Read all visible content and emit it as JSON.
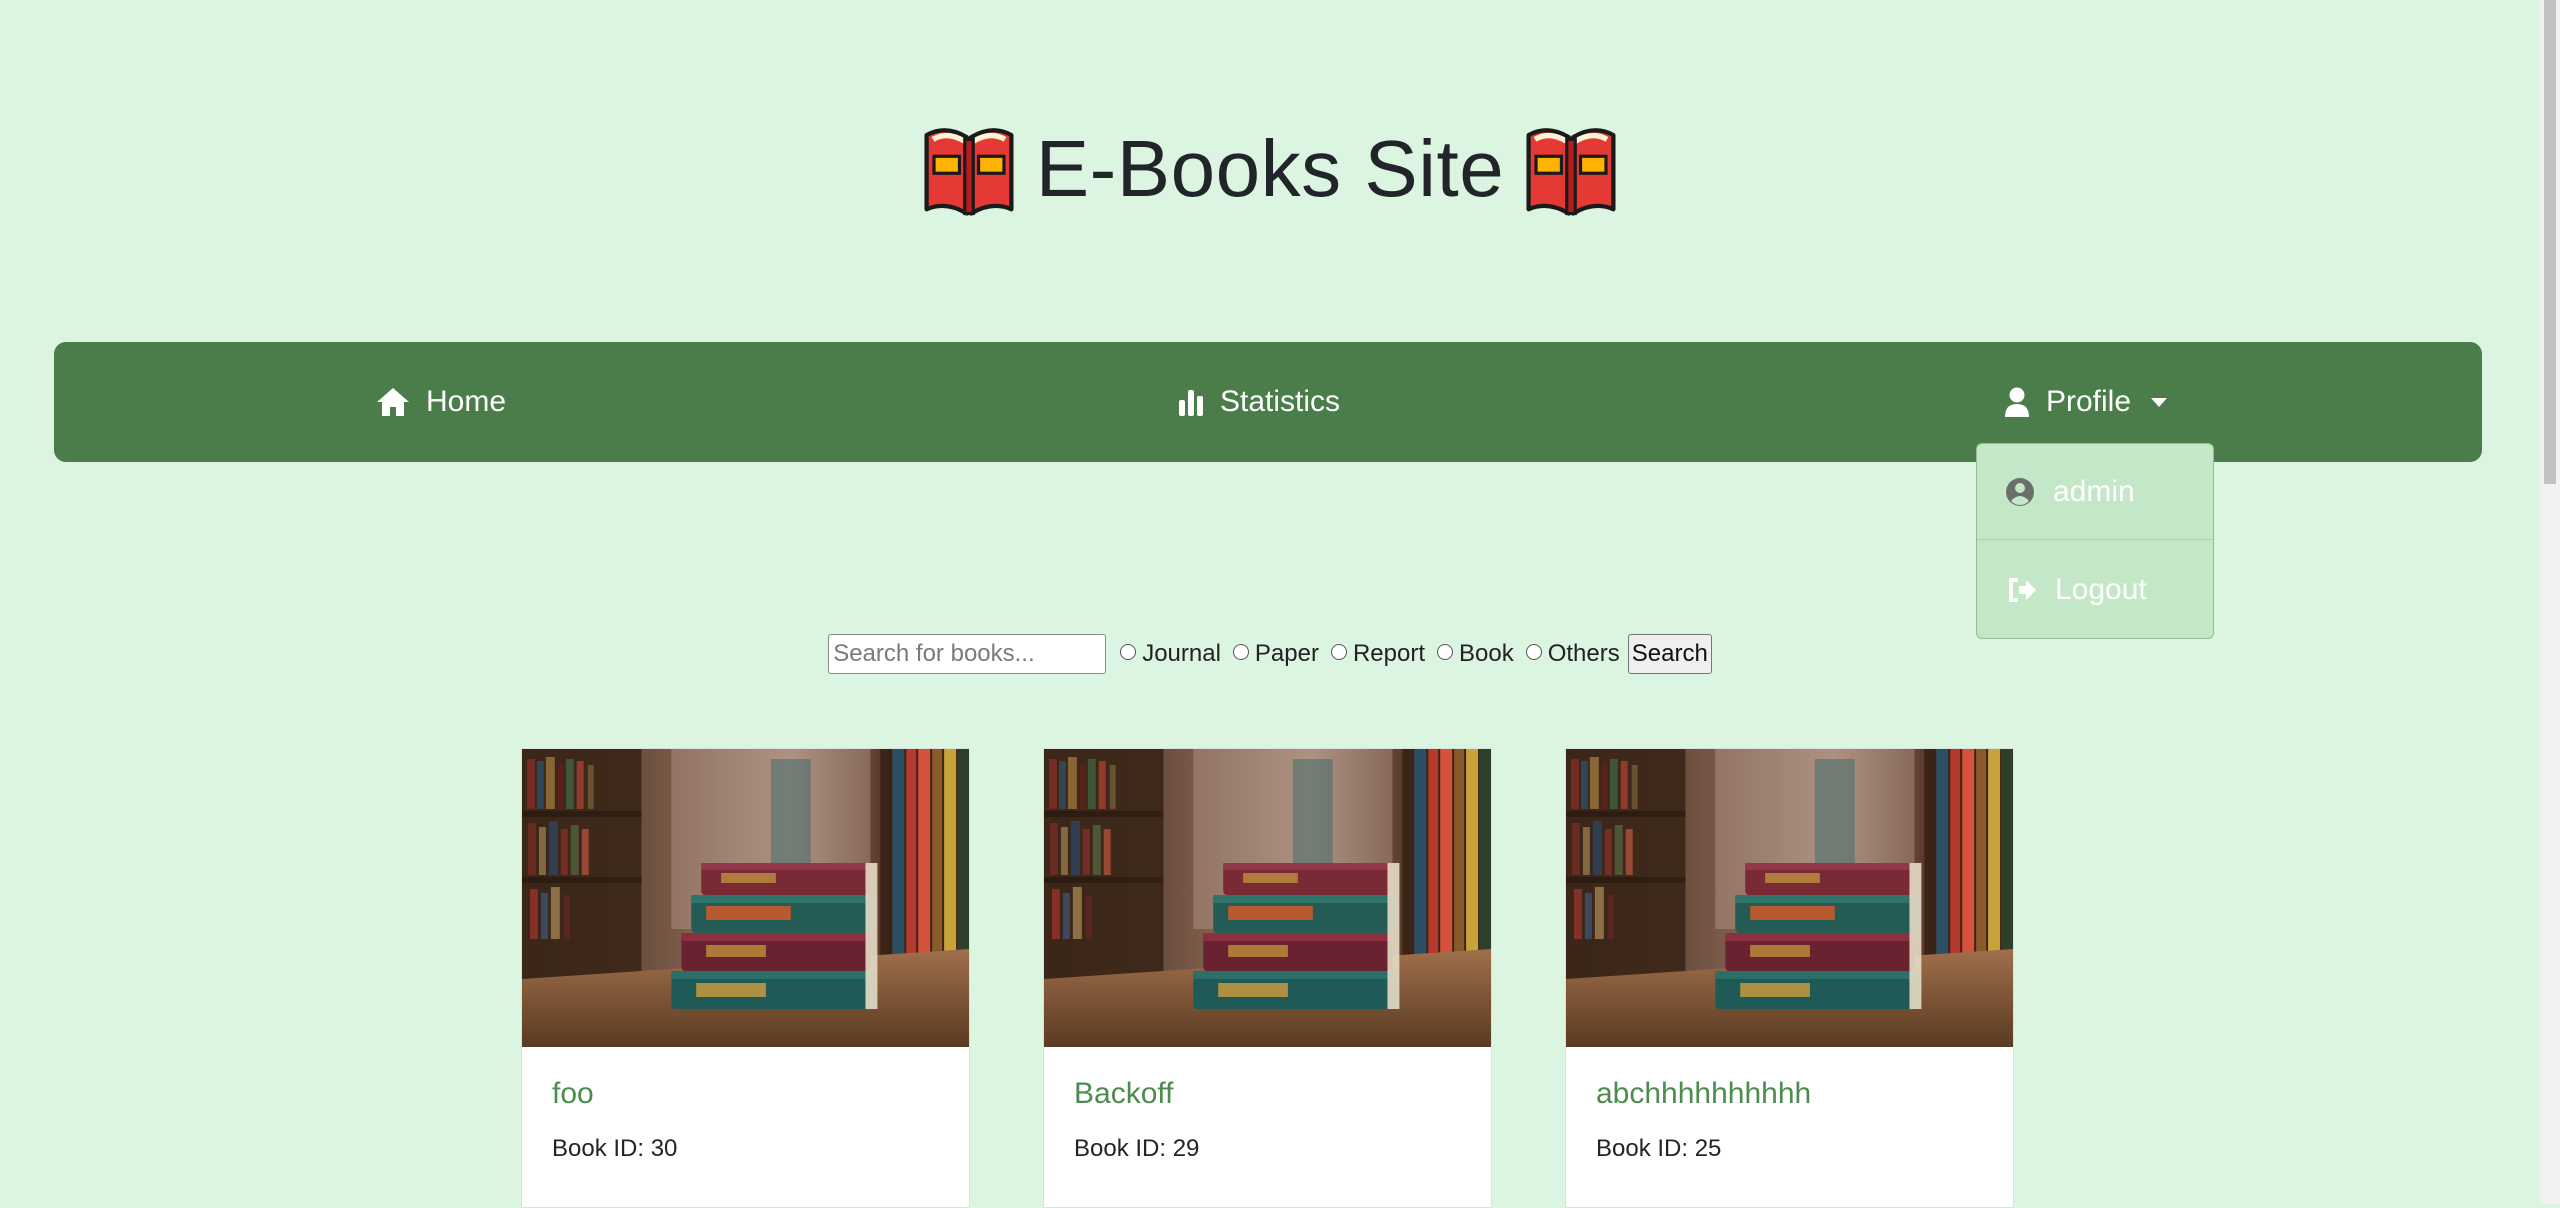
{
  "header": {
    "title": "E-Books Site",
    "logo_icon": "open-book-icon"
  },
  "nav": {
    "home_label": "Home",
    "statistics_label": "Statistics",
    "profile_label": "Profile"
  },
  "profile_menu": {
    "user_label": "admin",
    "logout_label": "Logout"
  },
  "search": {
    "placeholder": "Search for books...",
    "value": "",
    "filters": [
      "Journal",
      "Paper",
      "Report",
      "Book",
      "Others"
    ],
    "button_label": "Search"
  },
  "books": [
    {
      "title": "foo",
      "id_text": "Book ID: 30"
    },
    {
      "title": "Backoff",
      "id_text": "Book ID: 29"
    },
    {
      "title": "abchhhhhhhhhh",
      "id_text": "Book ID: 25"
    }
  ],
  "colors": {
    "page_bg": "#dcf5e1",
    "navbar": "#4a7d49",
    "dropdown": "#c4e7c8",
    "card_title": "#4d8b4f"
  }
}
